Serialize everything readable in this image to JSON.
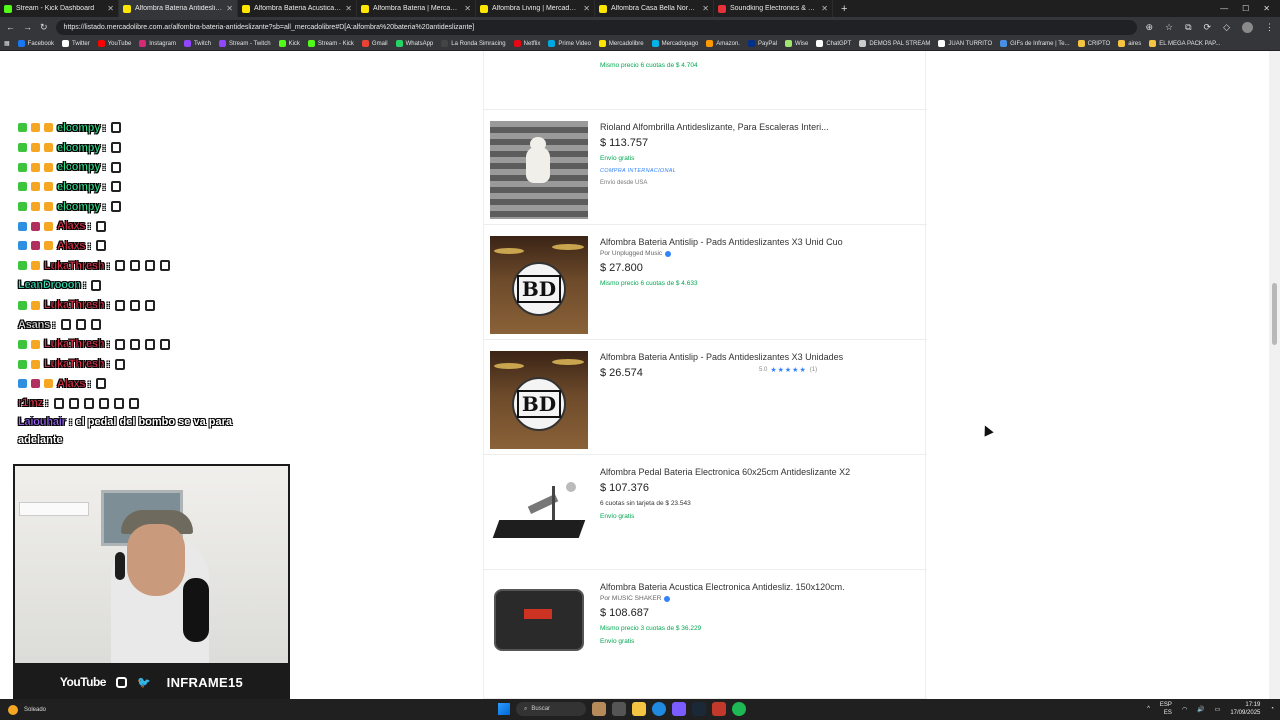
{
  "browser": {
    "tabs": [
      {
        "label": "Stream - Kick Dashboard",
        "color": "#53fc18"
      },
      {
        "label": "Alfombra Bateria Antideslizante |",
        "color": "#ffe600",
        "active": true
      },
      {
        "label": "Alfombra Bateria Acustica Electro",
        "color": "#ffe600"
      },
      {
        "label": "Alfombra Bateria | MercadoLibre",
        "color": "#ffe600"
      },
      {
        "label": "Alfombra Living | MercadoLibre",
        "color": "#ffe600"
      },
      {
        "label": "Alfombra Casa Bella Nordica Peli",
        "color": "#ffe600"
      },
      {
        "label": "Soundking Electronics & Sound",
        "color": "#e53238"
      }
    ],
    "new_tab": "+",
    "url": "https://listado.mercadolibre.com.ar/alfombra-bateria-antideslizante?sb=all_mercadolibre#D[A:alfombra%20bateria%20antideslizante]",
    "bookmarks": [
      {
        "label": "Facebook",
        "color": "#1877f2"
      },
      {
        "label": "Twitter",
        "color": "#ffffff"
      },
      {
        "label": "YouTube",
        "color": "#ff0000"
      },
      {
        "label": "Instagram",
        "color": "#d62976"
      },
      {
        "label": "Twitch",
        "color": "#9146ff"
      },
      {
        "label": "Stream - Twitch",
        "color": "#9146ff"
      },
      {
        "label": "Kick",
        "color": "#53fc18"
      },
      {
        "label": "Stream - Kick",
        "color": "#53fc18"
      },
      {
        "label": "Gmail",
        "color": "#ea4335"
      },
      {
        "label": "WhatsApp",
        "color": "#25d366"
      },
      {
        "label": "La Ronda Simracing",
        "color": "#444444"
      },
      {
        "label": "Netflix",
        "color": "#e50914"
      },
      {
        "label": "Prime Video",
        "color": "#00a8e1"
      },
      {
        "label": "Mercadolibre",
        "color": "#ffe600"
      },
      {
        "label": "Mercadopago",
        "color": "#00b1ea"
      },
      {
        "label": "Amazon.",
        "color": "#ff9900"
      },
      {
        "label": "PayPal",
        "color": "#003087"
      },
      {
        "label": "Wise",
        "color": "#9fe870"
      },
      {
        "label": "ChatGPT",
        "color": "#ffffff"
      },
      {
        "label": "DEMOS PAL STREAM",
        "color": "#cccccc"
      },
      {
        "label": "JUAN TURRITO",
        "color": "#ffffff"
      },
      {
        "label": "GIFs de Inframe | Te...",
        "color": "#4a90e2"
      },
      {
        "label": "CRIPTO",
        "color": "#f5c542"
      },
      {
        "label": "aires",
        "color": "#f5c542"
      },
      {
        "label": "EL MEGA PACK PAP...",
        "color": "#f5c542"
      }
    ]
  },
  "products": [
    {
      "title": "",
      "installments": "Mismo precio 6 cuotas de $ 4.704",
      "image": "drum-kit-bd"
    },
    {
      "title": "Rioland Alfombrilla Antideslizante, Para Escaleras Interi...",
      "price": "$ 113.757",
      "shipping": "Envío gratis",
      "intl": "COMPRA INTERNACIONAL",
      "origin": "Envío desde USA",
      "image": "stairs-dog"
    },
    {
      "title": "Alfombra Bateria Antislip - Pads Antideslizantes X3 Unid Cuo",
      "seller": "Por Unplugged Music",
      "price": "$ 27.800",
      "installments": "Mismo precio 6 cuotas de $ 4.633",
      "image": "drum-kit-bd"
    },
    {
      "title": "Alfombra Bateria Antislip - Pads Antideslizantes X3 Unidades",
      "price": "$ 26.574",
      "rating": "5.0",
      "stars": "★★★★★",
      "rating_count": "(1)",
      "image": "drum-kit-bd"
    },
    {
      "title": "Alfombra Pedal Bateria Electronica 60x25cm Antideslizante X2",
      "price": "$ 107.376",
      "installments": "6 cuotas sin tarjeta de $ 23.543",
      "shipping": "Envío gratis",
      "image": "pedal-mat"
    },
    {
      "title": "Alfombra Bateria Acustica Electronica Antidesliz. 150x120cm.",
      "seller": "Por MUSIC SHAKER",
      "price": "$ 108.687",
      "installments": "Mismo precio 3 cuotas de $ 36.229",
      "shipping": "Envío gratis",
      "image": "square-mat"
    }
  ],
  "chat": [
    {
      "user": "elcompy",
      "color": "#2fe08f",
      "badges": [
        "#3cc43c",
        "#f5a623",
        "#f5a623"
      ],
      "emotes": 1
    },
    {
      "user": "elcompy",
      "color": "#2fe08f",
      "badges": [
        "#3cc43c",
        "#f5a623",
        "#f5a623"
      ],
      "emotes": 1
    },
    {
      "user": "elcompy",
      "color": "#2fe08f",
      "badges": [
        "#3cc43c",
        "#f5a623",
        "#f5a623"
      ],
      "emotes": 1
    },
    {
      "user": "elcompy",
      "color": "#2fe08f",
      "badges": [
        "#3cc43c",
        "#f5a623",
        "#f5a623"
      ],
      "emotes": 1
    },
    {
      "user": "elcompy",
      "color": "#2fe08f",
      "badges": [
        "#3cc43c",
        "#f5a623",
        "#f5a623"
      ],
      "emotes": 1
    },
    {
      "user": "Alaxs",
      "color": "#e0324b",
      "badges": [
        "#2f8fe0",
        "#b03060",
        "#f5a623"
      ],
      "emotes": 1
    },
    {
      "user": "Alaxs",
      "color": "#e0324b",
      "badges": [
        "#2f8fe0",
        "#b03060",
        "#f5a623"
      ],
      "emotes": 1
    },
    {
      "user": "LukaThresh",
      "color": "#e0324b",
      "badges": [
        "#3cc43c",
        "#f5a623"
      ],
      "emotes": 4
    },
    {
      "user": "LeanDrooon",
      "color": "#2fe0b5",
      "badges": [],
      "emotes": 1
    },
    {
      "user": "LukaThresh",
      "color": "#e0324b",
      "badges": [
        "#3cc43c",
        "#f5a623"
      ],
      "emotes": 3
    },
    {
      "user": "Asans",
      "color": "#e6e6e6",
      "badges": [],
      "emotes": 3
    },
    {
      "user": "LukaThresh",
      "color": "#e0324b",
      "badges": [
        "#3cc43c",
        "#f5a623"
      ],
      "emotes": 4
    },
    {
      "user": "LukaThresh",
      "color": "#e0324b",
      "badges": [
        "#3cc43c",
        "#f5a623"
      ],
      "emotes": 1
    },
    {
      "user": "Alaxs",
      "color": "#e0324b",
      "badges": [
        "#2f8fe0",
        "#b03060",
        "#f5a623"
      ],
      "emotes": 1
    },
    {
      "user": "r1mz",
      "color": "#e0324b",
      "badges": [],
      "emotes": 6
    },
    {
      "user": "Laiouhair",
      "color": "#a066ff",
      "badges": [],
      "text": "el pedal del bombo se va para adelante",
      "emotes": 0
    }
  ],
  "stream": {
    "social_youtube": "YouTube",
    "handle": "INFRAME15"
  },
  "taskbar": {
    "weather": "Soleado",
    "search": "Buscar",
    "lang1": "ESP",
    "lang2": "ES",
    "time": "17:19",
    "date": "17/09/2025"
  }
}
